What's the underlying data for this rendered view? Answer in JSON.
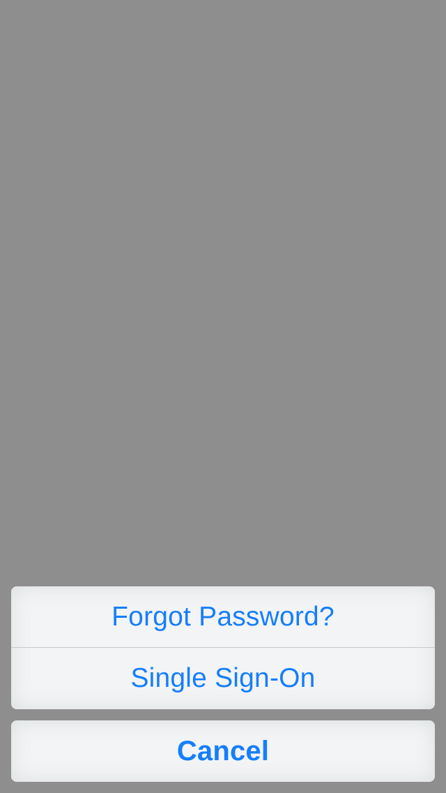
{
  "action_sheet": {
    "options": [
      {
        "label": "Forgot Password?"
      },
      {
        "label": "Single Sign-On"
      }
    ],
    "cancel_label": "Cancel"
  },
  "colors": {
    "overlay": "#8e8e8e",
    "sheet_background": "#f3f4f5",
    "action_text": "#157efb",
    "divider": "#c8c9cb"
  }
}
